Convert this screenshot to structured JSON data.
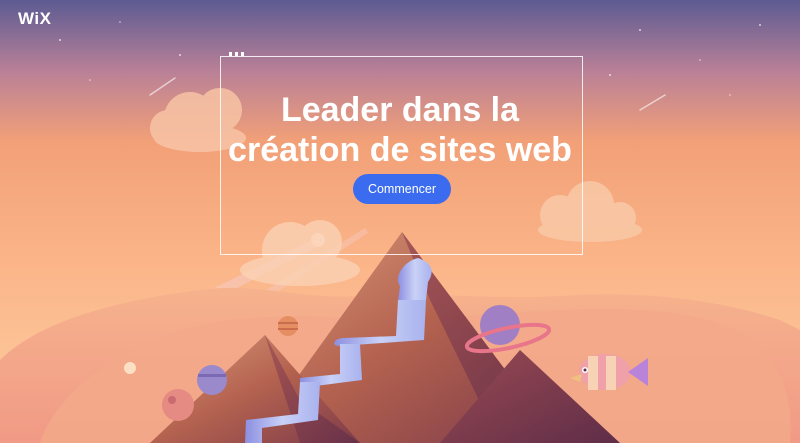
{
  "header": {
    "logo_text": "WiX"
  },
  "hero": {
    "title_line1": "Leader dans la",
    "title_line2": "création de sites web",
    "cta_label": "Commencer"
  },
  "colors": {
    "sky_top": "#5c5b92",
    "sky_mid": "#f2a077",
    "sky_bottom": "#fbc79a",
    "cta": "#3b6cf0",
    "mountain": "#b4624f",
    "waterfall": "#b8c4f3"
  },
  "illustration": {
    "icons": [
      "cloud-icon",
      "mountain-icon",
      "waterfall-icon",
      "planet-icon",
      "comet-icon",
      "fish-icon"
    ]
  }
}
